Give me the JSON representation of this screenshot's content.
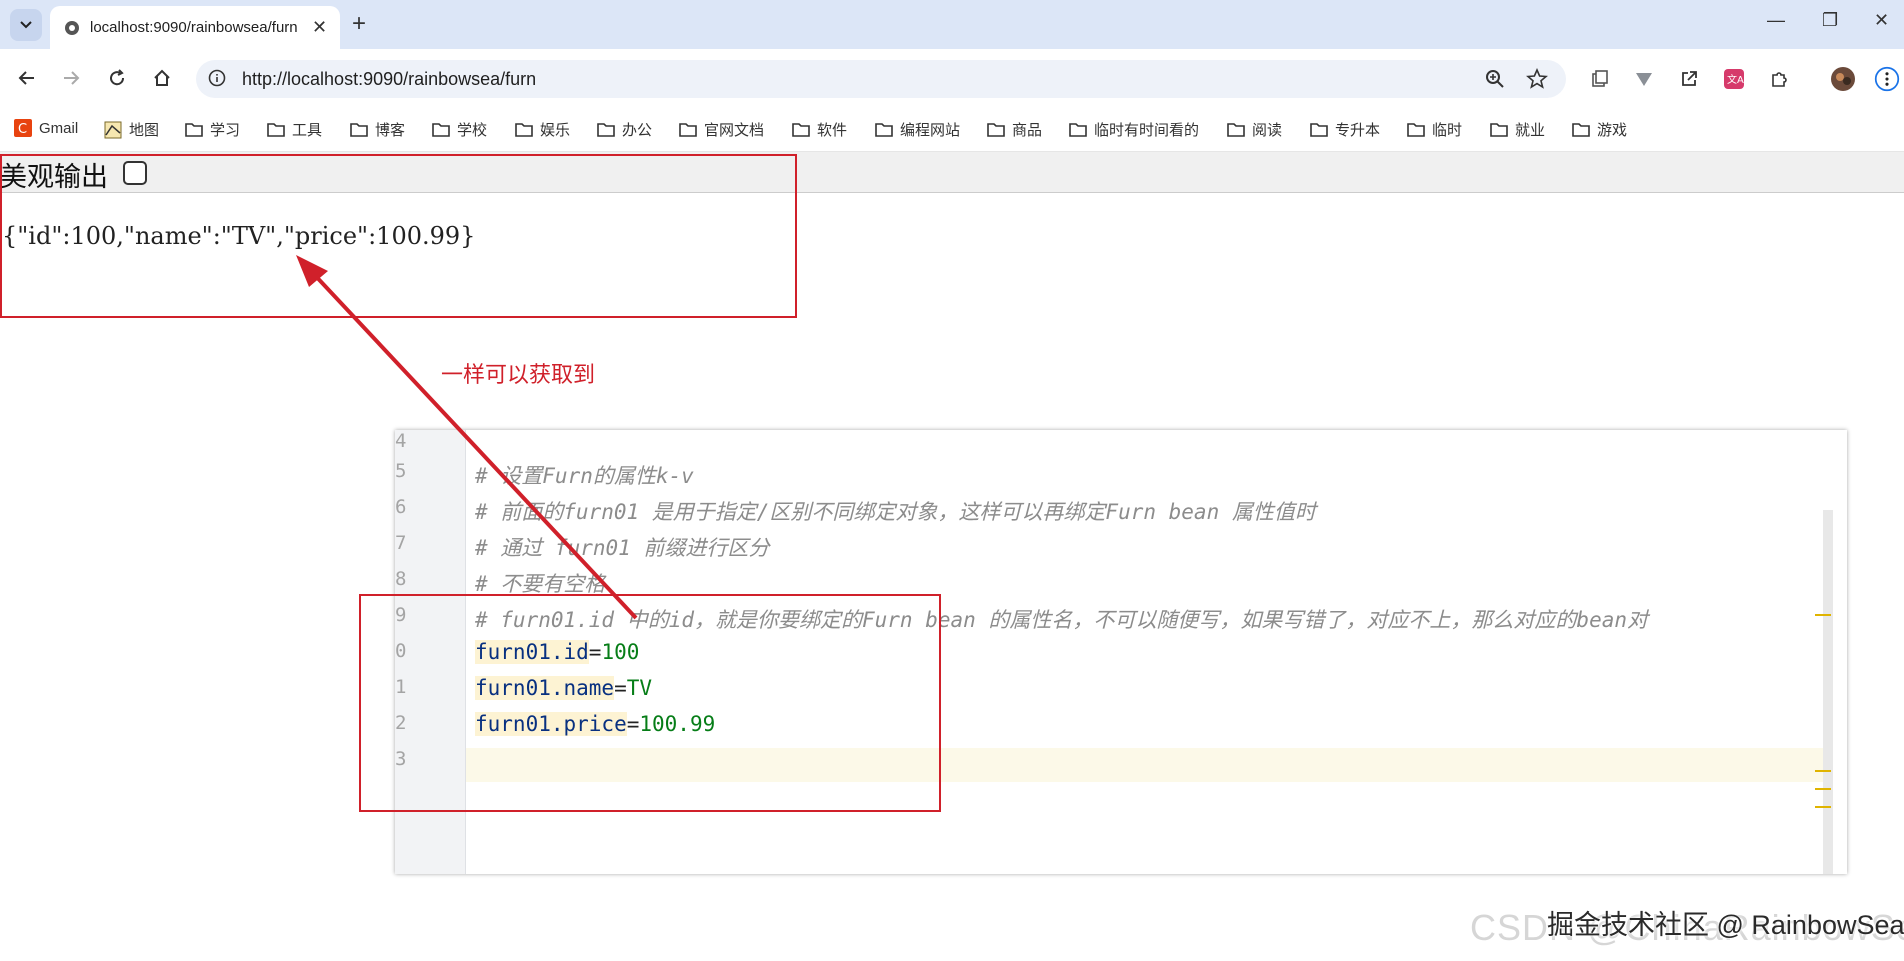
{
  "browser": {
    "tab": {
      "title": "localhost:9090/rainbowsea/furn"
    },
    "address": {
      "url": "http://localhost:9090/rainbowsea/furn"
    },
    "bookmarks": [
      {
        "label": "Gmail",
        "icon": "gmail-icon"
      },
      {
        "label": "地图",
        "icon": "map-icon"
      },
      {
        "label": "学习",
        "icon": "folder-icon"
      },
      {
        "label": "工具",
        "icon": "folder-icon"
      },
      {
        "label": "博客",
        "icon": "folder-icon"
      },
      {
        "label": "学校",
        "icon": "folder-icon"
      },
      {
        "label": "娱乐",
        "icon": "folder-icon"
      },
      {
        "label": "办公",
        "icon": "folder-icon"
      },
      {
        "label": "官网文档",
        "icon": "folder-icon"
      },
      {
        "label": "软件",
        "icon": "folder-icon"
      },
      {
        "label": "编程网站",
        "icon": "folder-icon"
      },
      {
        "label": "商品",
        "icon": "folder-icon"
      },
      {
        "label": "临时有时间看的",
        "icon": "folder-icon"
      },
      {
        "label": "阅读",
        "icon": "folder-icon"
      },
      {
        "label": "专升本",
        "icon": "folder-icon"
      },
      {
        "label": "临时",
        "icon": "folder-icon"
      },
      {
        "label": "就业",
        "icon": "folder-icon"
      },
      {
        "label": "游戏",
        "icon": "folder-icon"
      }
    ]
  },
  "page": {
    "pretty_label": "美观输出",
    "pretty_checked": false,
    "json_output": "{\"id\":100,\"name\":\"TV\",\"price\":100.99}"
  },
  "annotation": {
    "text": "一样可以获取到",
    "color": "#d0202a"
  },
  "editor": {
    "lines": [
      {
        "num": "4",
        "comment": ""
      },
      {
        "num": "5",
        "comment": "# 设置Furn的属性k-v"
      },
      {
        "num": "6",
        "comment": "# 前面的furn01 是用于指定/区别不同绑定对象，这样可以再绑定Furn bean 属性值时"
      },
      {
        "num": "7",
        "comment": "# 通过 furn01 前缀进行区分"
      },
      {
        "num": "8",
        "comment": "# 不要有空格"
      },
      {
        "num": "9",
        "comment": "# furn01.id 中的id，就是你要绑定的Furn bean 的属性名，不可以随便写，如果写错了，对应不上，那么对应的bean对"
      },
      {
        "num": "0",
        "key": "furn01.id",
        "value": "100"
      },
      {
        "num": "1",
        "key": "furn01.name",
        "value": "TV"
      },
      {
        "num": "2",
        "key": "furn01.price",
        "value": "100.99"
      },
      {
        "num": "3",
        "comment": ""
      }
    ]
  },
  "watermark": {
    "text": "CSDN @ChinaRainbowSea",
    "overlay": "掘金技术社区 @ RainbowSea"
  }
}
